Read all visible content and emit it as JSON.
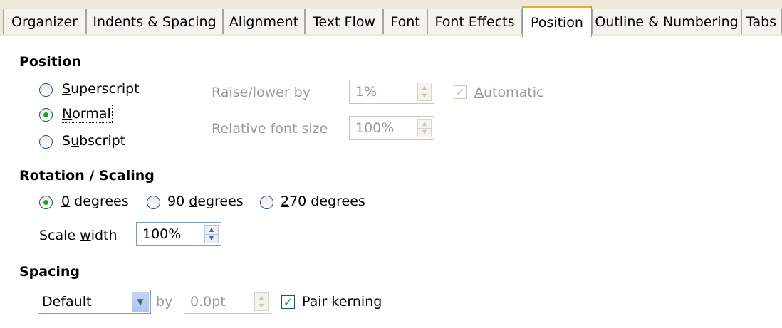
{
  "tabs": [
    {
      "label": "Organizer"
    },
    {
      "label": "Indents & Spacing"
    },
    {
      "label": "Alignment"
    },
    {
      "label": "Text Flow"
    },
    {
      "label": "Font"
    },
    {
      "label": "Font Effects"
    },
    {
      "label": "Position"
    },
    {
      "label": "Outline & Numbering"
    },
    {
      "label": "Tabs"
    }
  ],
  "active_tab": "Position",
  "position": {
    "header": "Position",
    "options": [
      {
        "label": "Superscript",
        "mnemonic": "S",
        "rest": "uperscript",
        "selected": false
      },
      {
        "label": "Normal",
        "mnemonic": "N",
        "rest": "ormal",
        "selected": true
      },
      {
        "label": "Subscript",
        "pre": "S",
        "mnemonic": "u",
        "rest": "bscript",
        "selected": false
      }
    ],
    "raise_lower": {
      "label": "Raise/lower by",
      "value": "1%",
      "enabled": false
    },
    "automatic": {
      "label": "Automatic",
      "checked": true,
      "enabled": false
    },
    "relative_size": {
      "label": "Relative font size",
      "value": "100%",
      "enabled": false
    }
  },
  "rotation": {
    "header": "Rotation / Scaling",
    "options": [
      {
        "label": "0 degrees",
        "selected": true
      },
      {
        "label": "90 degrees",
        "selected": false
      },
      {
        "label": "270 degrees",
        "selected": false
      }
    ],
    "scale_width": {
      "label": "Scale width",
      "value": "100%"
    }
  },
  "spacing": {
    "header": "Spacing",
    "mode": "Default",
    "by_label": "by",
    "by_value": "0.0pt",
    "pair_kerning": {
      "label": "Pair kerning",
      "checked": true
    }
  },
  "colors": {
    "accent_tab": "#f5a623",
    "radio_dot": "#21a121",
    "disabled_text": "#9c9a94"
  }
}
